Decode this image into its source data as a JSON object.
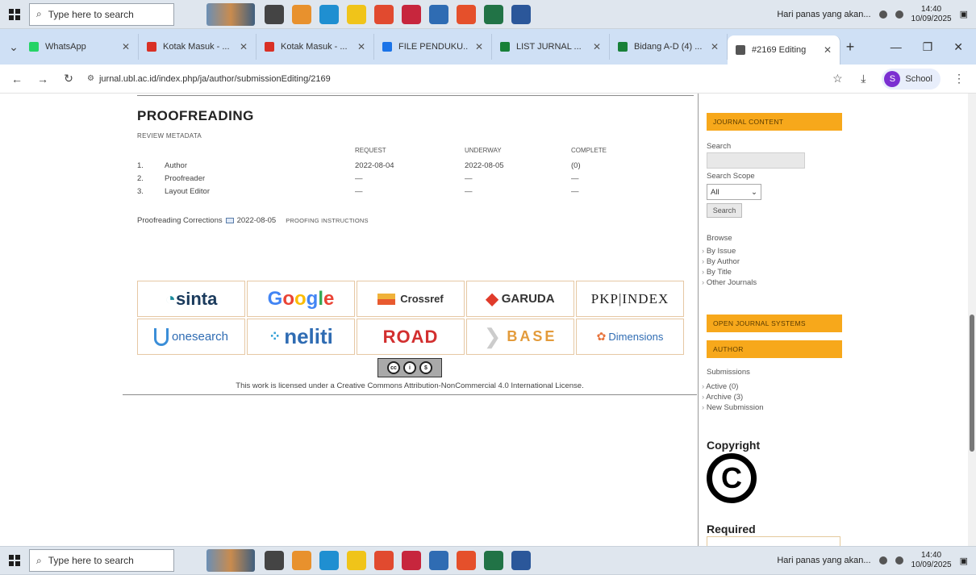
{
  "taskbar": {
    "search_placeholder": "Type here to search",
    "notification": "Hari panas yang akan...",
    "time": "14:40",
    "date": "10/09/2025"
  },
  "tabs": [
    {
      "label": "WhatsApp",
      "color": "#25d366"
    },
    {
      "label": "Kotak Masuk - ...",
      "color": "#d93025"
    },
    {
      "label": "Kotak Masuk - ...",
      "color": "#d93025"
    },
    {
      "label": "FILE PENDUKU...",
      "color": "#1a73e8"
    },
    {
      "label": "LIST JURNAL ...",
      "color": "#188038"
    },
    {
      "label": "Bidang A-D (4) ...",
      "color": "#188038"
    },
    {
      "label": "#2169 Editing",
      "color": "#555555"
    }
  ],
  "browser": {
    "url": "jurnal.ubl.ac.id/index.php/ja/author/submissionEditing/2169",
    "profile_label": "School",
    "profile_initial": "S"
  },
  "proofreading": {
    "title": "PROOFREADING",
    "review_metadata": "REVIEW METADATA",
    "headers": {
      "request": "REQUEST",
      "underway": "UNDERWAY",
      "complete": "COMPLETE"
    },
    "rows": [
      {
        "num": "1.",
        "role": "Author",
        "request": "2022-08-04",
        "underway": "2022-08-05",
        "complete": "(0)"
      },
      {
        "num": "2.",
        "role": "Proofreader",
        "request": "—",
        "underway": "—",
        "complete": "—"
      },
      {
        "num": "3.",
        "role": "Layout Editor",
        "request": "—",
        "underway": "—",
        "complete": "—"
      }
    ],
    "corrections_label": "Proofreading Corrections",
    "corrections_date": "2022-08-05",
    "instructions_link": "PROOFING INSTRUCTIONS"
  },
  "indexing_logos": [
    {
      "name": "sinta"
    },
    {
      "name": "Google"
    },
    {
      "name": "Crossref"
    },
    {
      "name": "GARUDA"
    },
    {
      "name": "PKP|INDEX"
    },
    {
      "name": "onesearch"
    },
    {
      "name": "neliti"
    },
    {
      "name": "ROAD"
    },
    {
      "name": "BASE"
    },
    {
      "name": "Dimensions"
    }
  ],
  "license": {
    "badge": "cc by nc",
    "prefix": "This work is licensed under a ",
    "link_text": "Creative Commons Attribution-NonCommercial 4.0 International License",
    "suffix": "."
  },
  "sidebar": {
    "journal_content": "JOURNAL CONTENT",
    "search_label": "Search",
    "scope_label": "Search Scope",
    "scope_value": "All",
    "search_button": "Search",
    "browse_label": "Browse",
    "browse_items": [
      "By Issue",
      "By Author",
      "By Title",
      "Other Journals"
    ],
    "ojs_header": "OPEN JOURNAL SYSTEMS",
    "author_header": "AUTHOR",
    "submissions_label": "Submissions",
    "submission_items": [
      "Active (0)",
      "Archive (3)",
      "New Submission"
    ],
    "copyright_heading": "Copyright",
    "required_heading": "Required"
  }
}
